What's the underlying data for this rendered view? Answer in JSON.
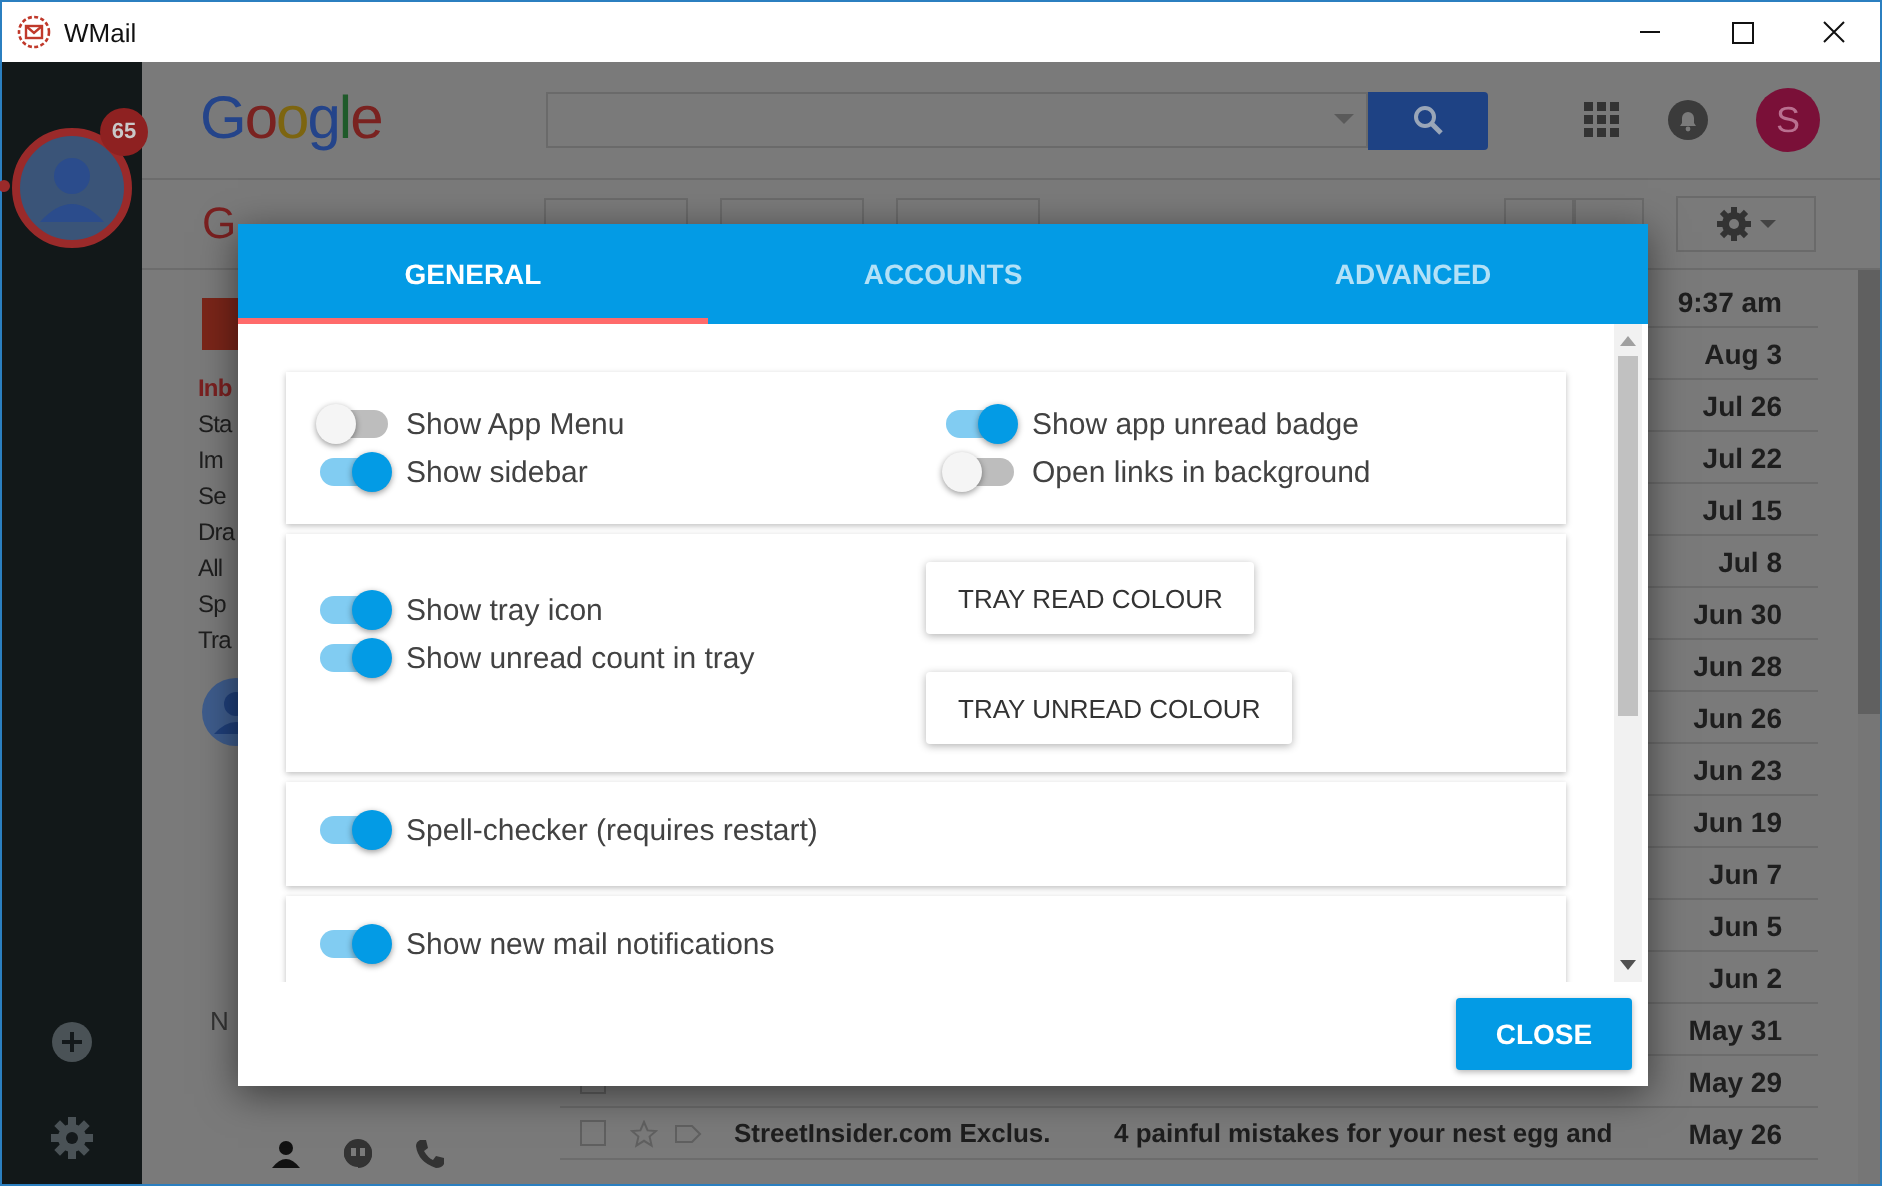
{
  "window": {
    "title": "WMail"
  },
  "rail": {
    "account_badge": "65"
  },
  "gmail": {
    "logo": "Google",
    "avatar": "S",
    "app_label": "G",
    "nav": [
      {
        "label": "Inb",
        "selected": true
      },
      {
        "label": "Sta",
        "selected": false
      },
      {
        "label": "Im",
        "selected": false
      },
      {
        "label": "Se",
        "selected": false
      },
      {
        "label": "Dra",
        "selected": false
      },
      {
        "label": "All",
        "selected": false
      },
      {
        "label": "Sp",
        "selected": false
      },
      {
        "label": "Tra",
        "selected": false
      }
    ],
    "nav_footer": "N",
    "mail": [
      {
        "date": "9:37 am"
      },
      {
        "date": "Aug 3"
      },
      {
        "date": "Jul 26"
      },
      {
        "date": "Jul 22"
      },
      {
        "date": "Jul 15"
      },
      {
        "date": "Jul 8"
      },
      {
        "date": "Jun 30"
      },
      {
        "date": "Jun 28"
      },
      {
        "date": "Jun 26"
      },
      {
        "date": "Jun 23"
      },
      {
        "date": "Jun 19"
      },
      {
        "date": "Jun 7"
      },
      {
        "date": "Jun 5"
      },
      {
        "date": "Jun 2"
      },
      {
        "date": "May 31"
      },
      {
        "date": "May 29"
      },
      {
        "checked": false,
        "sender": "StreetInsider.com Exclus.",
        "subject": "4 painful mistakes for your nest egg and",
        "date": "May 26"
      }
    ]
  },
  "dialog": {
    "tabs": [
      {
        "label": "GENERAL",
        "selected": true
      },
      {
        "label": "ACCOUNTS",
        "selected": false
      },
      {
        "label": "ADVANCED",
        "selected": false
      }
    ],
    "cards": [
      {
        "kind": "grid",
        "toggles": [
          {
            "label": "Show App Menu",
            "on": false
          },
          {
            "label": "Show app unread badge",
            "on": true
          },
          {
            "label": "Show sidebar",
            "on": true
          },
          {
            "label": "Open links in background",
            "on": false
          }
        ]
      },
      {
        "kind": "split",
        "toggles": [
          {
            "label": "Show tray icon",
            "on": true
          },
          {
            "label": "Show unread count in tray",
            "on": true
          }
        ],
        "buttons": [
          "TRAY READ COLOUR",
          "TRAY UNREAD COLOUR"
        ]
      },
      {
        "kind": "list",
        "toggles": [
          {
            "label": "Spell-checker (requires restart)",
            "on": true
          }
        ]
      },
      {
        "kind": "list",
        "toggles": [
          {
            "label": "Show new mail notifications",
            "on": true
          }
        ]
      }
    ],
    "close": "CLOSE"
  }
}
